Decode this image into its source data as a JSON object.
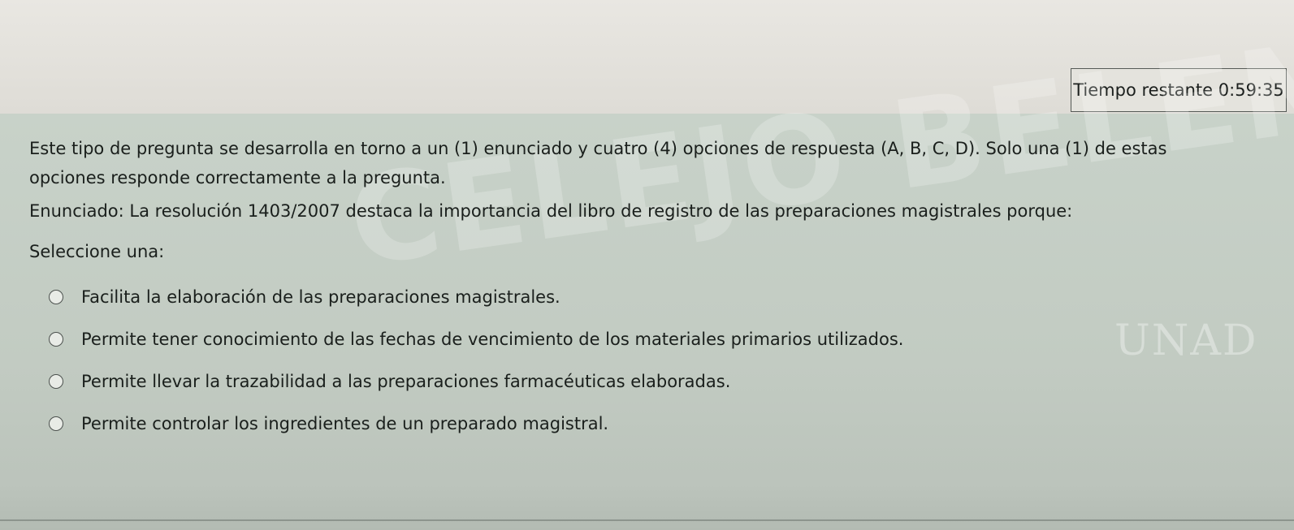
{
  "timer": {
    "label": "Tiempo restante",
    "value": "0:59:35"
  },
  "question": {
    "instructions": "Este tipo de pregunta se desarrolla en torno a un (1) enunciado y cuatro (4) opciones de respuesta (A, B, C, D). Solo una (1) de estas opciones responde correctamente a la pregunta.",
    "statement": "Enunciado: La resolución 1403/2007 destaca la importancia del libro de registro de las preparaciones magistrales porque:",
    "select_label": "Seleccione una:",
    "options": [
      {
        "label": "Facilita la elaboración de las preparaciones magistrales."
      },
      {
        "label": "Permite tener conocimiento de las fechas de vencimiento de los materiales primarios utilizados."
      },
      {
        "label": "Permite llevar la trazabilidad a las preparaciones farmacéuticas elaboradas."
      },
      {
        "label": "Permite controlar los ingredientes de un preparado magistral."
      }
    ]
  },
  "watermark": {
    "text": "CELEJO BELENO",
    "logo": "UNAD"
  }
}
